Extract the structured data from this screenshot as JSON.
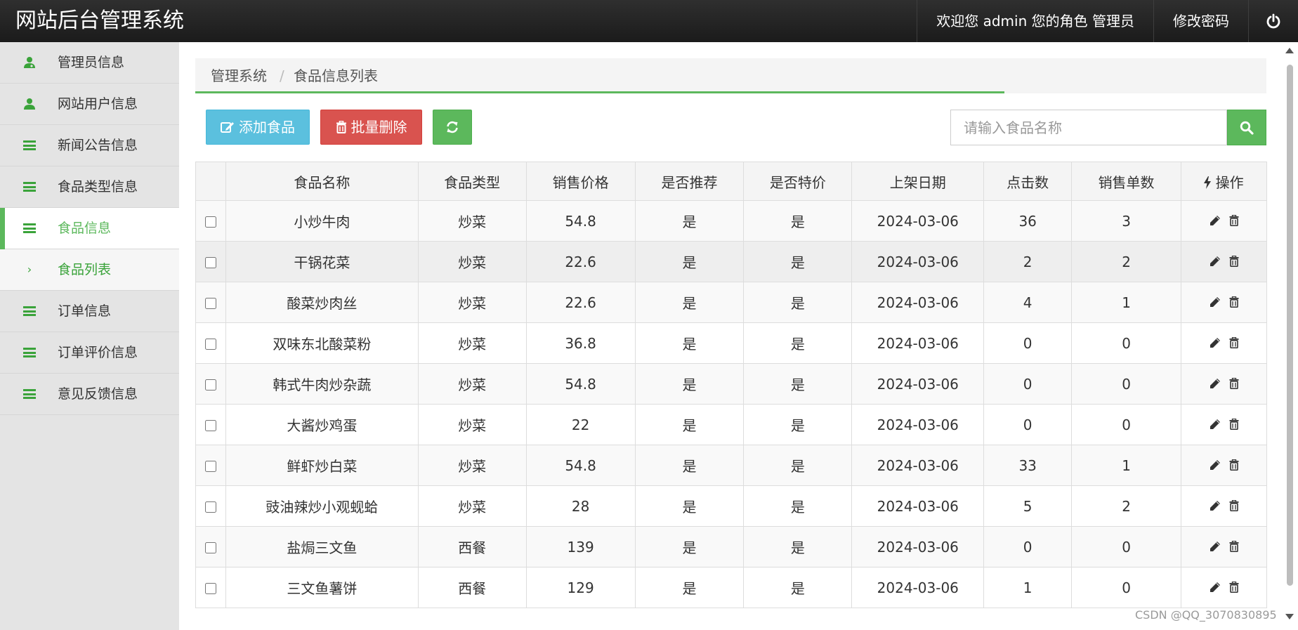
{
  "header": {
    "title": "网站后台管理系统",
    "welcome": "欢迎您 admin 您的角色 管理员",
    "change_password": "修改密码",
    "power_icon": "power-icon"
  },
  "sidebar": {
    "items": [
      {
        "label": "管理员信息",
        "icon": "user-md-icon"
      },
      {
        "label": "网站用户信息",
        "icon": "user-icon"
      },
      {
        "label": "新闻公告信息",
        "icon": "bars-icon"
      },
      {
        "label": "食品类型信息",
        "icon": "bars-icon"
      },
      {
        "label": "食品信息",
        "icon": "bars-icon",
        "active": true
      },
      {
        "label": "食品列表",
        "icon": "chevron-right-icon",
        "sub": true
      },
      {
        "label": "订单信息",
        "icon": "bars-icon"
      },
      {
        "label": "订单评价信息",
        "icon": "bars-icon"
      },
      {
        "label": "意见反馈信息",
        "icon": "bars-icon"
      }
    ]
  },
  "breadcrumb": {
    "root": "管理系统",
    "separator": "/",
    "current": "食品信息列表"
  },
  "toolbar": {
    "add_label": "添加食品",
    "batch_delete_label": "批量删除",
    "refresh_icon": "refresh-icon"
  },
  "search": {
    "placeholder": "请输入食品名称",
    "value": ""
  },
  "table": {
    "columns": [
      "",
      "食品名称",
      "食品类型",
      "销售价格",
      "是否推荐",
      "是否特价",
      "上架日期",
      "点击数",
      "销售单数",
      "操作"
    ],
    "rows": [
      {
        "name": "小炒牛肉",
        "type": "炒菜",
        "price": "54.8",
        "recommend": "是",
        "special": "是",
        "date": "2024-03-06",
        "clicks": "36",
        "sales": "3"
      },
      {
        "name": "干锅花菜",
        "type": "炒菜",
        "price": "22.6",
        "recommend": "是",
        "special": "是",
        "date": "2024-03-06",
        "clicks": "2",
        "sales": "2"
      },
      {
        "name": "酸菜炒肉丝",
        "type": "炒菜",
        "price": "22.6",
        "recommend": "是",
        "special": "是",
        "date": "2024-03-06",
        "clicks": "4",
        "sales": "1"
      },
      {
        "name": "双味东北酸菜粉",
        "type": "炒菜",
        "price": "36.8",
        "recommend": "是",
        "special": "是",
        "date": "2024-03-06",
        "clicks": "0",
        "sales": "0"
      },
      {
        "name": "韩式牛肉炒杂蔬",
        "type": "炒菜",
        "price": "54.8",
        "recommend": "是",
        "special": "是",
        "date": "2024-03-06",
        "clicks": "0",
        "sales": "0"
      },
      {
        "name": "大酱炒鸡蛋",
        "type": "炒菜",
        "price": "22",
        "recommend": "是",
        "special": "是",
        "date": "2024-03-06",
        "clicks": "0",
        "sales": "0"
      },
      {
        "name": "鲜虾炒白菜",
        "type": "炒菜",
        "price": "54.8",
        "recommend": "是",
        "special": "是",
        "date": "2024-03-06",
        "clicks": "33",
        "sales": "1"
      },
      {
        "name": "豉油辣炒小观蚬蛤",
        "type": "炒菜",
        "price": "28",
        "recommend": "是",
        "special": "是",
        "date": "2024-03-06",
        "clicks": "5",
        "sales": "2"
      },
      {
        "name": "盐焗三文鱼",
        "type": "西餐",
        "price": "139",
        "recommend": "是",
        "special": "是",
        "date": "2024-03-06",
        "clicks": "0",
        "sales": "0"
      },
      {
        "name": "三文鱼薯饼",
        "type": "西餐",
        "price": "129",
        "recommend": "是",
        "special": "是",
        "date": "2024-03-06",
        "clicks": "1",
        "sales": "0"
      }
    ]
  },
  "colors": {
    "accent": "#5cb85c",
    "info": "#5bc0de",
    "danger": "#d9534f",
    "topbar": "#222222"
  },
  "watermark": "CSDN @QQ_3070830895"
}
